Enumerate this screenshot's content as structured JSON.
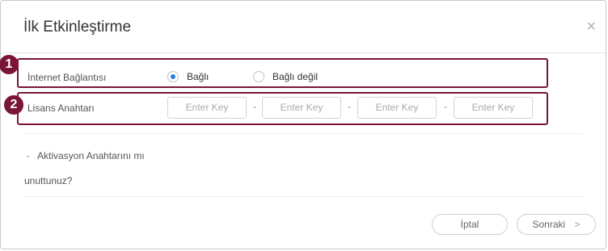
{
  "dialog": {
    "title": "İlk Etkinleştirme",
    "close_glyph": "×"
  },
  "internet": {
    "label": "İnternet Bağlantısı",
    "options": [
      {
        "label": "Bağlı",
        "selected": true
      },
      {
        "label": "Bağlı değil",
        "selected": false
      }
    ]
  },
  "license": {
    "label": "Lisans Anahtarı",
    "placeholder": "Enter Key",
    "separator": "-"
  },
  "forgot": {
    "line1": "Aktivasyon Anahtarını mı",
    "line2": "unuttunuz?"
  },
  "buttons": {
    "cancel": "İptal",
    "next": "Sonraki",
    "next_arrow": ">"
  },
  "badges": [
    "1",
    "2"
  ],
  "colors": {
    "highlight": "#7a1535",
    "radio_selected": "#2d7ee0"
  }
}
